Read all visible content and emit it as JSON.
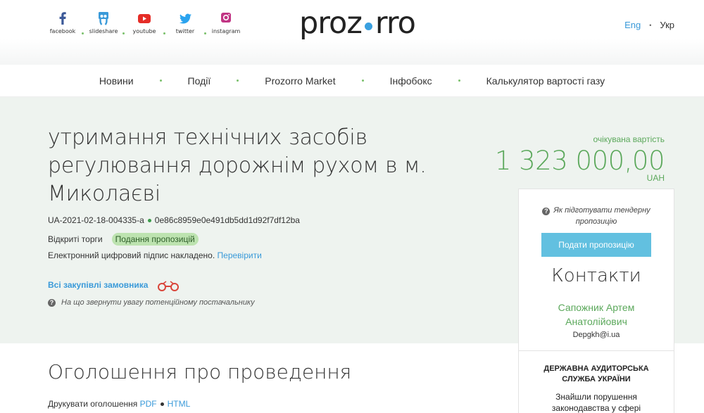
{
  "header": {
    "socials": [
      {
        "name": "facebook",
        "label": "facebook",
        "icon": "facebook-icon",
        "color": "#3b5998"
      },
      {
        "name": "slideshare",
        "label": "slideshare",
        "icon": "slideshare-icon",
        "color": "#3a9ad9"
      },
      {
        "name": "youtube",
        "label": "youtube",
        "icon": "youtube-icon",
        "color": "#e52d27"
      },
      {
        "name": "twitter",
        "label": "twitter",
        "icon": "twitter-icon",
        "color": "#2aa3ef"
      },
      {
        "name": "instagram",
        "label": "instagram",
        "icon": "instagram-icon",
        "color": "#c13584"
      }
    ],
    "logo_left": "proz",
    "logo_right": "rro",
    "lang_eng": "Eng",
    "lang_ukr": "Укр"
  },
  "nav": {
    "items": [
      "Новини",
      "Події",
      "Prozorro Market",
      "Інфобокс",
      "Калькулятор вартості газу"
    ]
  },
  "tender": {
    "title": "утримання технічних засобів регулювання дорожнім рухом в м. Миколаєві",
    "tender_id": "UA-2021-02-18-004335-a",
    "hash": "0e86c8959e0e491db5dd1d92f7df12ba",
    "procedure": "Відкриті торги",
    "status": "Подання пропозицій",
    "signature_text": "Електронний цифровий підпис накладено.",
    "signature_link": "Перевірити",
    "buyer_link": "Всі закупівлі замовника",
    "hint": "На що звернути увагу потенційному постачальнику"
  },
  "price": {
    "label": "очікувана вартість",
    "value": "1 323 000,00",
    "currency": "UAH"
  },
  "panel": {
    "prepare_hint": "Як підготувати тендерну пропозицію",
    "submit_button": "Подати пропозицію",
    "contacts_title": "Контакти",
    "contact_name": "Сапожник Артем Анатолійович",
    "contact_email": "Depgkh@i.ua",
    "audit_title": "ДЕРЖАВНА АУДИТОРСЬКА СЛУЖБА УКРАЇНИ",
    "audit_question": "Знайшли порушення законодавства у сфері закупівель?"
  },
  "announcement": {
    "title": "Оголошення про проведення",
    "print_label": "Друкувати оголошення",
    "pdf": "PDF",
    "html": "HTML"
  },
  "colors": {
    "accent_green": "#5ba85b",
    "link_blue": "#3a9ad9",
    "button_blue": "#62c0e0",
    "hero_bg": "#eef3ef"
  }
}
